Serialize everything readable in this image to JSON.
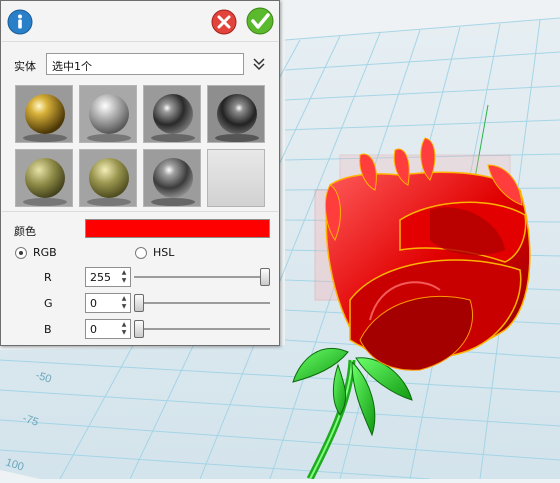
{
  "panel": {
    "entity_label": "实体",
    "entity_value": "选中1个",
    "color_label": "颜色",
    "color_value": "#ff0000",
    "mode": {
      "rgb_label": "RGB",
      "hsl_label": "HSL",
      "selected": "RGB"
    },
    "channels": [
      {
        "label": "R",
        "value": "255",
        "level": 1.0
      },
      {
        "label": "G",
        "value": "0",
        "level": 0.0
      },
      {
        "label": "B",
        "value": "0",
        "level": 0.0
      }
    ],
    "materials": [
      {
        "name": "gold-metal"
      },
      {
        "name": "silver-chrome"
      },
      {
        "name": "dark-chrome"
      },
      {
        "name": "dark-chrome-2"
      },
      {
        "name": "olive-matte"
      },
      {
        "name": "olive-satin"
      },
      {
        "name": "gray-chrome"
      },
      {
        "name": "empty"
      }
    ]
  },
  "viewport": {
    "axis_labels": [
      "-50",
      "-75",
      "100"
    ],
    "model": "rose",
    "model_color": "#ff0000",
    "stem_color": "#22cc22"
  }
}
